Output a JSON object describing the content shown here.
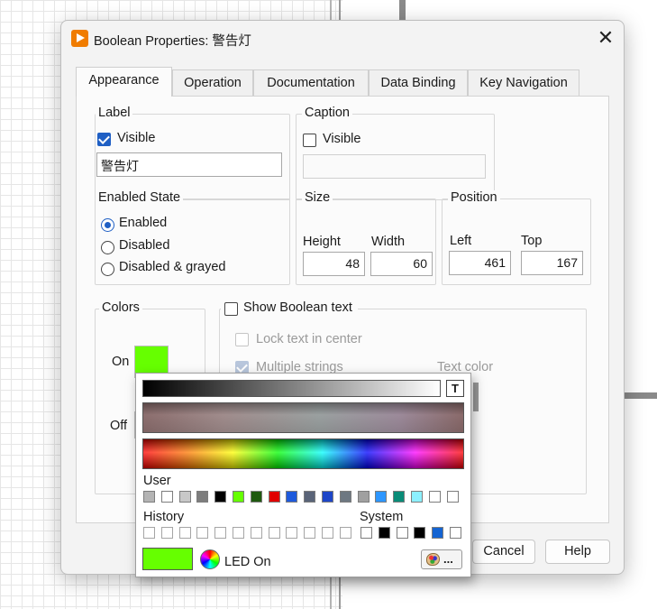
{
  "dialog": {
    "title": "Boolean Properties: 警告灯",
    "close": "✕"
  },
  "tabs": [
    "Appearance",
    "Operation",
    "Documentation",
    "Data Binding",
    "Key Navigation"
  ],
  "label_group": {
    "title": "Label",
    "visible_label": "Visible",
    "visible_checked": true,
    "value": "警告灯"
  },
  "caption_group": {
    "title": "Caption",
    "visible_label": "Visible",
    "visible_checked": false,
    "value": ""
  },
  "enabled_state": {
    "title": "Enabled State",
    "options": [
      "Enabled",
      "Disabled",
      "Disabled & grayed"
    ],
    "selected": "Enabled"
  },
  "size": {
    "title": "Size",
    "height_label": "Height",
    "width_label": "Width",
    "height": "48",
    "width": "60"
  },
  "position": {
    "title": "Position",
    "left_label": "Left",
    "top_label": "Top",
    "left": "461",
    "top": "167"
  },
  "colors": {
    "title": "Colors",
    "on_label": "On",
    "off_label": "Off",
    "on_color": "#66ff00"
  },
  "boolean_text": {
    "show_label": "Show Boolean text",
    "lock_label": "Lock text in center",
    "multiple_label": "Multiple strings",
    "text_color_label": "Text color"
  },
  "buttons": {
    "cancel": "Cancel",
    "help": "Help"
  },
  "picker": {
    "text_icon": "T",
    "user_label": "User",
    "history_label": "History",
    "system_label": "System",
    "user_colors": [
      "#b4b4b4",
      "#ffffff",
      "#c8c8c8",
      "#7d7d7d",
      "#000000",
      "#66ff00",
      "#1f5a10",
      "#e00000",
      "#1e5adc",
      "#5a6478",
      "#1e46c8",
      "#6e7882",
      "#a0a0a0",
      "#2d96ff",
      "#0a8c78",
      "#8cf0ff",
      "#ffffff",
      "#ffffff"
    ],
    "system_colors": [
      "#ffffff",
      "#000000",
      "#ffffff",
      "#000000",
      "#1464d2",
      "#ffffff"
    ],
    "current_color": "#66ff00",
    "current_label": "LED On",
    "more_label": "..."
  }
}
